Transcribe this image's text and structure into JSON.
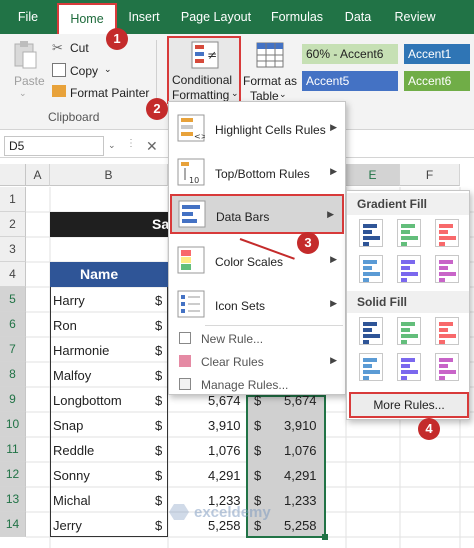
{
  "ribbon_tabs": [
    "File",
    "Home",
    "Insert",
    "Page Layout",
    "Formulas",
    "Data",
    "Review"
  ],
  "clipboard": {
    "paste_label": "Paste",
    "cut_label": "Cut",
    "copy_label": "Copy",
    "format_painter_label": "Format Painter",
    "group_label": "Clipboard"
  },
  "conditional_formatting": {
    "line1": "Conditional",
    "line2": "Formatting"
  },
  "format_as_table": {
    "line1": "Format as",
    "line2": "Table"
  },
  "styles": [
    "60% - Accent6",
    "Accent1",
    "Accent5",
    "Accent6"
  ],
  "name_box": "D5",
  "columns": [
    "A",
    "B",
    "E",
    "F"
  ],
  "rows": [
    "1",
    "2",
    "3",
    "4",
    "5",
    "6",
    "7",
    "8",
    "9",
    "10",
    "11",
    "12",
    "13",
    "14"
  ],
  "table": {
    "title_fragment": "Sa",
    "header": "Name",
    "names": [
      "Harry",
      "Ron",
      "Harmonie",
      "Malfoy",
      "Longbottom",
      "Snap",
      "Reddle",
      "Sonny",
      "Michal",
      "Jerry"
    ],
    "currency": "$",
    "values_c": [
      "5,674",
      "3,910",
      "1,076",
      "4,291",
      "1,233",
      "5,258"
    ],
    "values_d": [
      "5,674",
      "3,910",
      "1,076",
      "4,291",
      "1,233",
      "5,258"
    ]
  },
  "menu": {
    "highlight": "Highlight Cells Rules",
    "topbottom": "Top/Bottom Rules",
    "databars": "Data Bars",
    "colorscales": "Color Scales",
    "iconsets": "Icon Sets",
    "newrule": "New Rule...",
    "clearrules": "Clear Rules",
    "managerules": "Manage Rules..."
  },
  "submenu": {
    "gradient": "Gradient Fill",
    "solid": "Solid Fill",
    "more": "More Rules..."
  },
  "badges": [
    "1",
    "2",
    "3",
    "4"
  ],
  "colors": {
    "ribbon_green": "#217346",
    "badge_red": "#c42b2b",
    "header_blue": "#2f5597"
  }
}
